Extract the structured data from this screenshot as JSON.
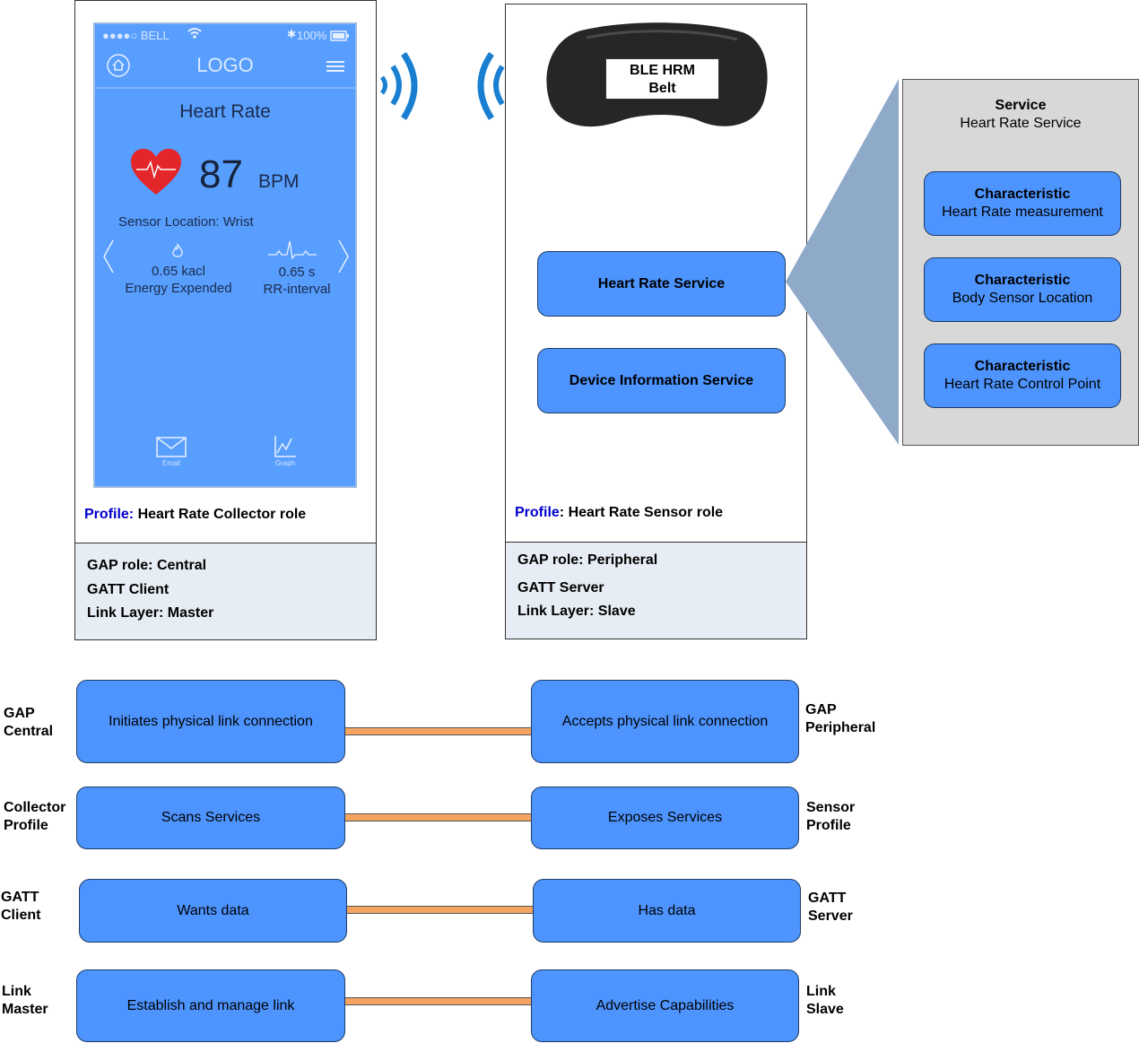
{
  "phone": {
    "status_carrier": "●●●●○ BELL",
    "status_battery": "100%",
    "logo": "LOGO",
    "title": "Heart Rate",
    "bpm_value": "87",
    "bpm_unit": "BPM",
    "sensor_location": "Sensor Location: Wrist",
    "energy_value": "0.65 kacl",
    "energy_label": "Energy Expended",
    "rr_value": "0.65 s",
    "rr_label": "RR-interval",
    "email_label": "Email",
    "graph_label": "Graph"
  },
  "collector": {
    "profile_key": "Profile:",
    "profile_value": "Heart Rate Collector role",
    "gap_role": "GAP role: Central",
    "gatt": "GATT Client",
    "link_layer": "Link Layer: Master"
  },
  "sensor": {
    "device_line1": "BLE HRM",
    "device_line2": "Belt",
    "service1": "Heart Rate Service",
    "service2": "Device Information Service",
    "profile_key": "Profile",
    "profile_value": ": Heart Rate Sensor role",
    "gap_role": "GAP role: Peripheral",
    "gatt": "GATT Server",
    "link_layer": "Link Layer: Slave"
  },
  "service_detail": {
    "heading": "Service",
    "name": "Heart Rate Service",
    "characteristics": [
      {
        "kind": "Characteristic",
        "name": "Heart Rate measurement"
      },
      {
        "kind": "Characteristic",
        "name": "Body Sensor Location"
      },
      {
        "kind": "Characteristic",
        "name": "Heart Rate Control Point"
      }
    ]
  },
  "relations": [
    {
      "left_label_1": "GAP",
      "left_label_2": "Central",
      "left_box": "Initiates physical link connection",
      "right_box": "Accepts physical link connection",
      "right_label_1": "GAP",
      "right_label_2": "Peripheral"
    },
    {
      "left_label_1": "Collector",
      "left_label_2": "Profile",
      "left_box": "Scans Services",
      "right_box": "Exposes Services",
      "right_label_1": "Sensor",
      "right_label_2": "Profile"
    },
    {
      "left_label_1": "GATT",
      "left_label_2": "Client",
      "left_box": "Wants data",
      "right_box": "Has data",
      "right_label_1": "GATT",
      "right_label_2": "Server"
    },
    {
      "left_label_1": "Link",
      "left_label_2": "Master",
      "left_box": "Establish and manage link",
      "right_box": "Advertise Capabilities",
      "right_label_1": "Link",
      "right_label_2": "Slave"
    }
  ],
  "colors": {
    "box_blue": "#4d94ff",
    "connector_orange": "#f4a460",
    "profile_key_blue": "#0000cc"
  }
}
